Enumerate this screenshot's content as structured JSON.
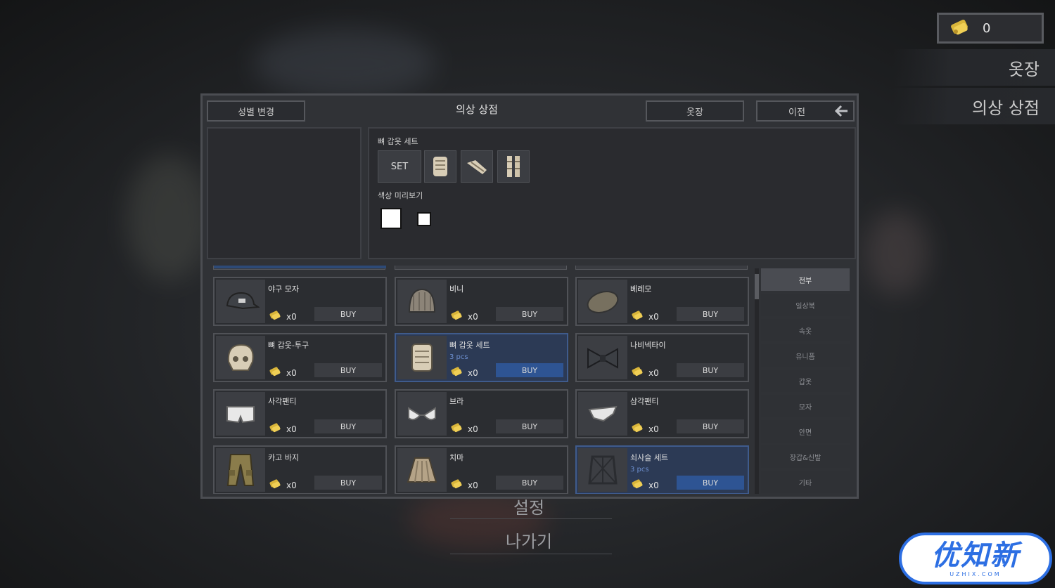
{
  "currency": {
    "icon": "gold-ticket-icon",
    "amount": "0"
  },
  "side_menu": {
    "wardrobe": "옷장",
    "costume_shop": "의상 상점"
  },
  "bg_menu": {
    "settings": "설정",
    "exit": "나가기"
  },
  "panel": {
    "title": "의상 상점",
    "gender_button": "성별 변경",
    "wardrobe_button": "옷장",
    "back_button": "이전",
    "back_icon": "arrow-left-icon"
  },
  "info": {
    "set_name": "뼈 갑옷 세트",
    "set_label": "SET",
    "color_preview_label": "색상 미리보기",
    "set_part_icons": [
      "bone-armor-top-icon",
      "bone-armor-arm-icon",
      "bone-armor-legs-icon"
    ]
  },
  "items": [
    {
      "name": "야구 모자",
      "pcs": "",
      "count": "x0",
      "buy": "BUY",
      "icon": "baseball-cap-icon",
      "highlight": false
    },
    {
      "name": "비니",
      "pcs": "",
      "count": "x0",
      "buy": "BUY",
      "icon": "beanie-icon",
      "highlight": false
    },
    {
      "name": "베레모",
      "pcs": "",
      "count": "x0",
      "buy": "BUY",
      "icon": "beret-icon",
      "highlight": false
    },
    {
      "name": "뼈 갑옷-투구",
      "pcs": "",
      "count": "x0",
      "buy": "BUY",
      "icon": "bone-helmet-icon",
      "highlight": false
    },
    {
      "name": "뼈 갑옷 세트",
      "pcs": "3 pcs",
      "count": "x0",
      "buy": "BUY",
      "icon": "bone-armor-icon",
      "highlight": true
    },
    {
      "name": "나비넥타이",
      "pcs": "",
      "count": "x0",
      "buy": "BUY",
      "icon": "bowtie-icon",
      "highlight": false
    },
    {
      "name": "사각팬티",
      "pcs": "",
      "count": "x0",
      "buy": "BUY",
      "icon": "boxers-icon",
      "highlight": false
    },
    {
      "name": "브라",
      "pcs": "",
      "count": "x0",
      "buy": "BUY",
      "icon": "bra-icon",
      "highlight": false
    },
    {
      "name": "삼각팬티",
      "pcs": "",
      "count": "x0",
      "buy": "BUY",
      "icon": "briefs-icon",
      "highlight": false
    },
    {
      "name": "카고 바지",
      "pcs": "",
      "count": "x0",
      "buy": "BUY",
      "icon": "cargo-pants-icon",
      "highlight": false
    },
    {
      "name": "치마",
      "pcs": "",
      "count": "x0",
      "buy": "BUY",
      "icon": "skirt-icon",
      "highlight": false
    },
    {
      "name": "쇠사슬 세트",
      "pcs": "3 pcs",
      "count": "x0",
      "buy": "BUY",
      "icon": "chainmail-icon",
      "highlight": true
    }
  ],
  "categories": [
    "전부",
    "일상복",
    "속옷",
    "유니폼",
    "갑옷",
    "모자",
    "안면",
    "장갑&신발",
    "기타"
  ],
  "active_category": "전부",
  "watermark": {
    "main": "优知新",
    "sub": "UZHIX.COM"
  }
}
